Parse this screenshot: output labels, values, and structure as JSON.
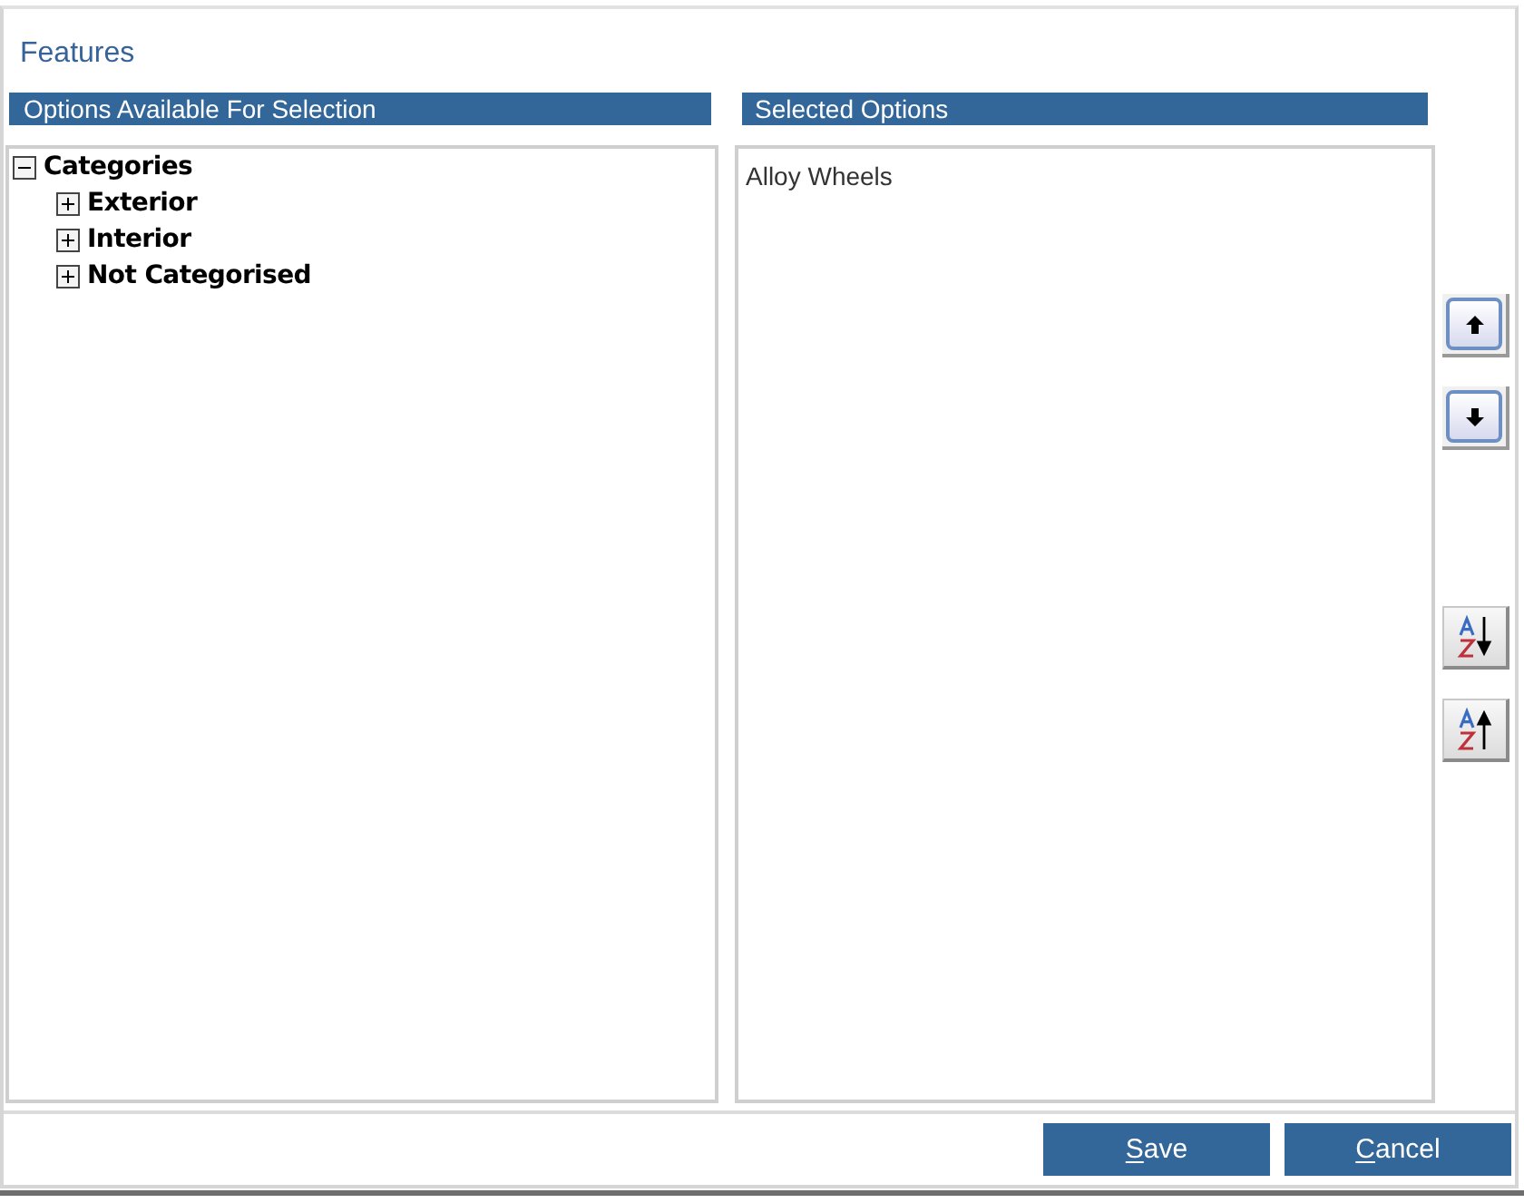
{
  "dialog": {
    "title": "Features"
  },
  "available": {
    "header": "Options Available For Selection",
    "tree": [
      {
        "label": "Categories",
        "expanded": true,
        "children": [
          {
            "label": "Exterior",
            "expanded": false
          },
          {
            "label": "Interior",
            "expanded": false
          },
          {
            "label": "Not Categorised",
            "expanded": false
          }
        ]
      }
    ]
  },
  "selected": {
    "header": "Selected Options",
    "items": [
      "Alloy Wheels"
    ]
  },
  "side_buttons": [
    {
      "kind": "move_up"
    },
    {
      "kind": "move_down"
    },
    {
      "kind": "sort_ascending"
    },
    {
      "kind": "sort_descending"
    }
  ],
  "footer_buttons": [
    {
      "label": "Save",
      "mnemonic": true
    },
    {
      "label": "Cancel",
      "mnemonic": true
    }
  ]
}
